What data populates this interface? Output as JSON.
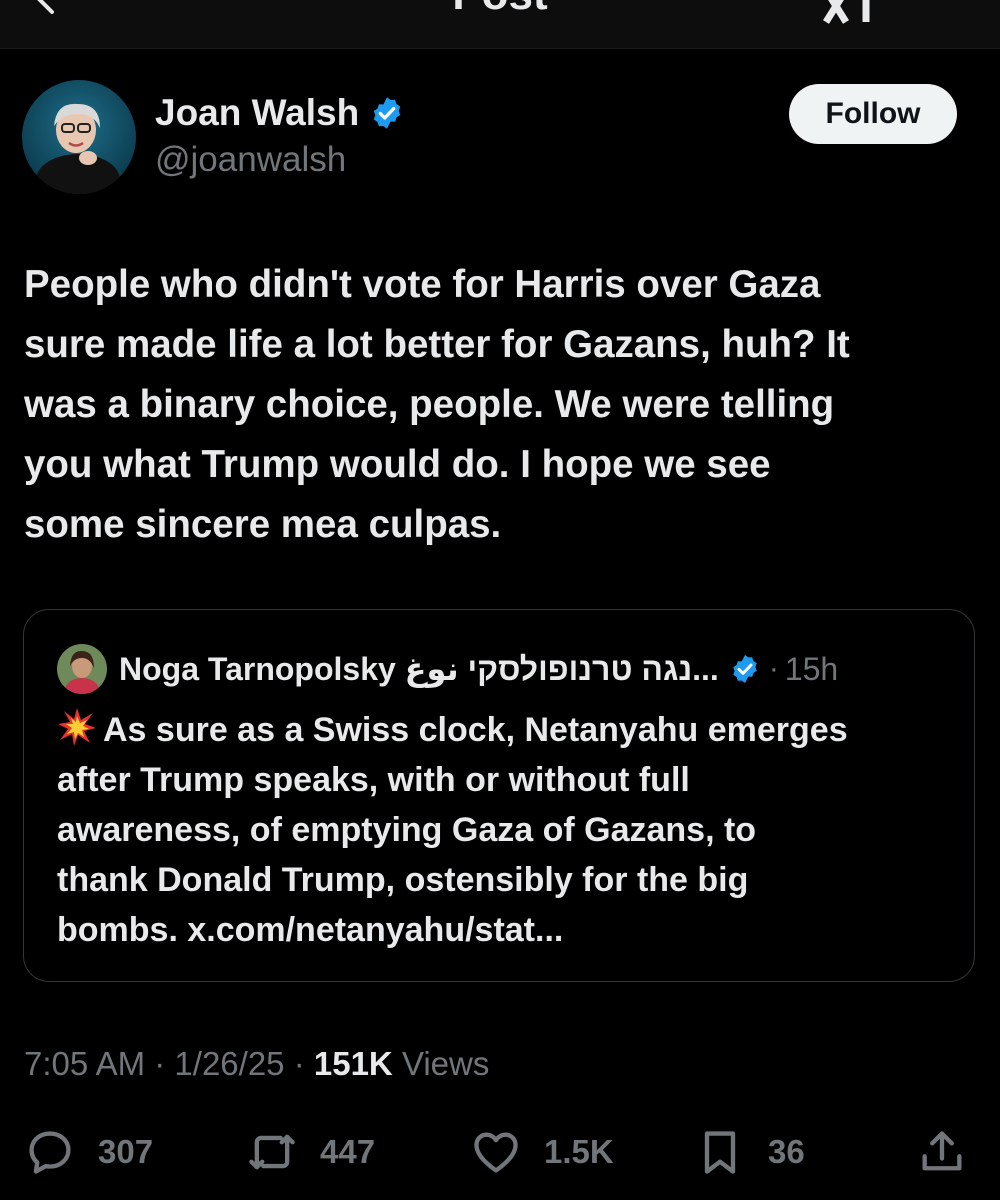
{
  "header": {
    "title": "Post"
  },
  "author": {
    "name": "Joan Walsh",
    "handle": "@joanwalsh",
    "follow_label": "Follow"
  },
  "post": {
    "lines": [
      "People who didn't vote for Harris over Gaza",
      "sure made life a lot better for Gazans, huh? It",
      "was a binary choice, people. We were telling",
      "you what Trump would do. I hope we see",
      "some sincere mea culpas."
    ]
  },
  "quote": {
    "author_name": "Noga Tarnopolsky נגה טרנופולסקי نوغ...",
    "time": "15h",
    "lines": [
      "As sure as a Swiss clock, Netanyahu emerges",
      "after Trump speaks, with or without full",
      "awareness, of emptying Gaza of Gazans, to",
      "thank Donald Trump, ostensibly for the big",
      "bombs. x.com/netanyahu/stat..."
    ]
  },
  "meta": {
    "time": "7:05 AM",
    "date": "1/26/25",
    "views_count": "151K",
    "views_label": "Views"
  },
  "actions": {
    "replies": "307",
    "reposts": "447",
    "likes": "1.5K",
    "bookmarks": "36"
  },
  "colors": {
    "background": "#000000",
    "text": "#e7e9ea",
    "secondary": "#71767b",
    "verified": "#1d9bf0",
    "follow_bg": "#eff3f4"
  }
}
